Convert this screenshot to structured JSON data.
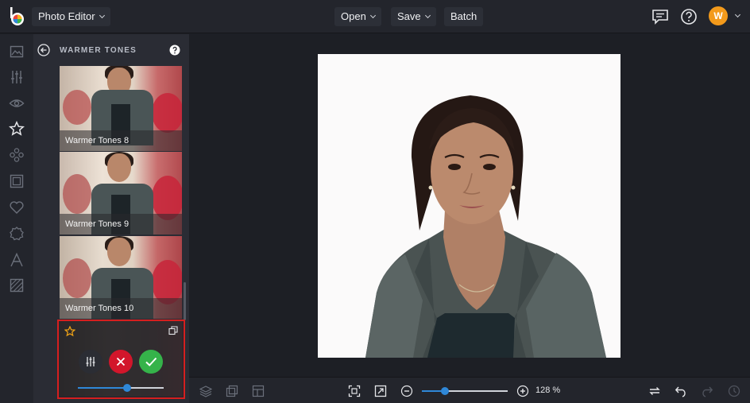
{
  "header": {
    "app_label": "Photo Editor",
    "menu": [
      "Open",
      "Save",
      "Batch"
    ],
    "avatar_initial": "W"
  },
  "rail": {
    "icons": [
      "image-icon",
      "sliders-icon",
      "eye-icon",
      "star-icon",
      "effects-icon",
      "frame-icon",
      "heart-icon",
      "badge-icon",
      "text-icon",
      "texture-icon"
    ],
    "active": "star-icon"
  },
  "panel": {
    "title": "WARMER TONES",
    "thumbnails": [
      "Warmer Tones 8",
      "Warmer Tones 9",
      "Warmer Tones 10"
    ],
    "intensity": 0.57
  },
  "bottombar": {
    "zoom_label": "128 %",
    "zoom_level": 0.27
  },
  "colors": {
    "accent": "#2f88d8",
    "cancel": "#d2162b",
    "apply": "#35b34a",
    "avatar": "#f39a1b",
    "highlight_box": "#d61f1f"
  }
}
